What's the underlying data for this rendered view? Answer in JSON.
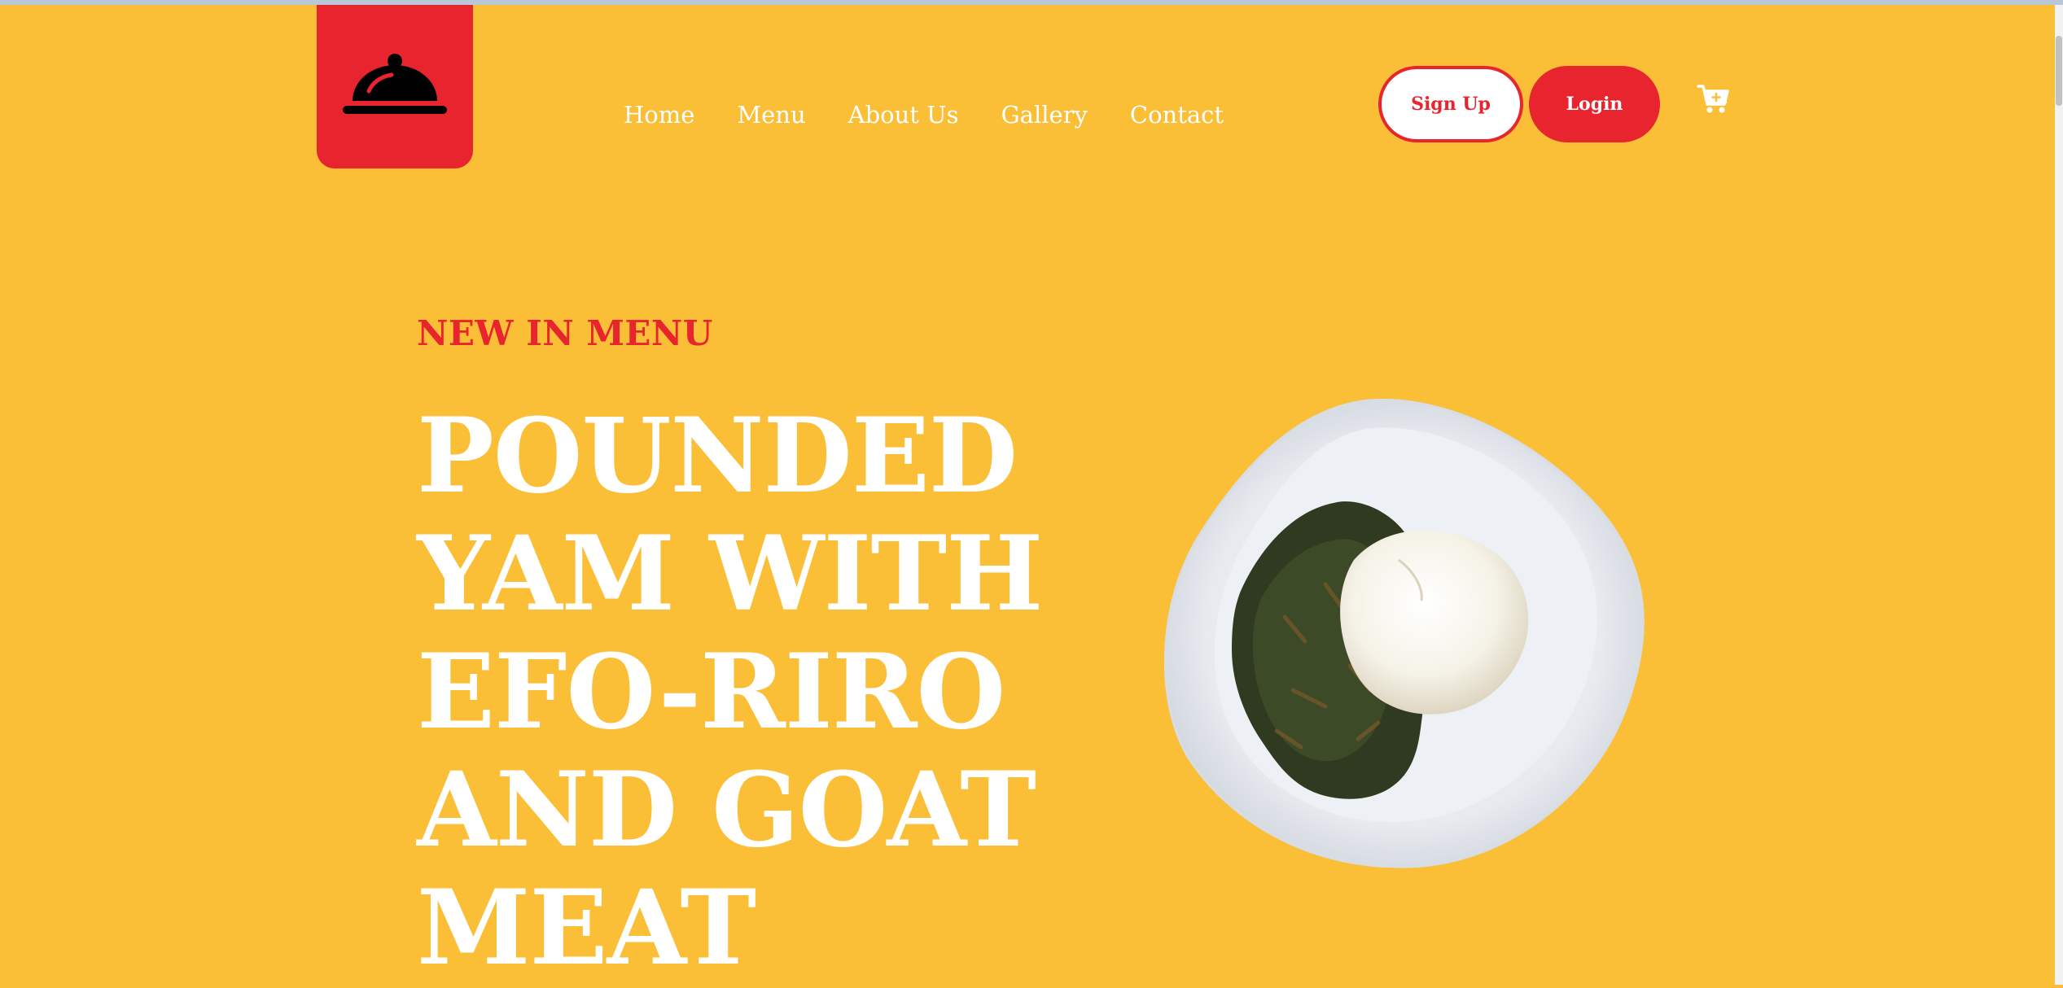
{
  "nav": {
    "logo_icon": "cloche-icon",
    "items": [
      {
        "label": "Home"
      },
      {
        "label": "Menu"
      },
      {
        "label": "About Us"
      },
      {
        "label": "Gallery"
      },
      {
        "label": "Contact"
      }
    ]
  },
  "auth": {
    "signup_label": "Sign Up",
    "login_label": "Login"
  },
  "cart": {
    "icon": "cart-icon"
  },
  "hero": {
    "eyebrow": "NEW IN MENU",
    "title_lines": [
      "POUNDED",
      "YAM WITH",
      "EFO-RIRO",
      "AND GOAT",
      "MEAT"
    ],
    "image": "plate-of-pounded-yam-with-efo-riro"
  },
  "colors": {
    "background": "#FBBE37",
    "accent": "#E8242E",
    "text_light": "#FFFFFF"
  }
}
